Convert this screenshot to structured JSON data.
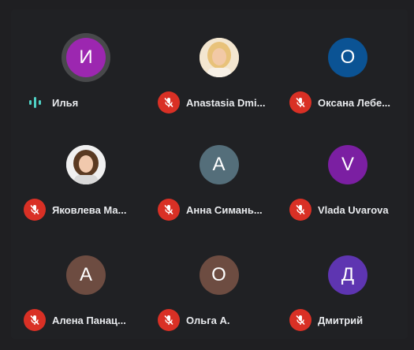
{
  "participants": [
    {
      "name": "Илья",
      "initial": "И",
      "color": "#9c27b0",
      "muted": false,
      "speaking": true,
      "avatar": "letter"
    },
    {
      "name": "Anastasia Dmi...",
      "initial": "",
      "color": "#f0d4a8",
      "muted": true,
      "speaking": false,
      "avatar": "photo-blonde"
    },
    {
      "name": "Оксана Лебе...",
      "initial": "О",
      "color": "#0b5394",
      "muted": true,
      "speaking": false,
      "avatar": "letter"
    },
    {
      "name": "Яковлева Ма...",
      "initial": "",
      "color": "#eeeeee",
      "muted": true,
      "speaking": false,
      "avatar": "photo-brunette"
    },
    {
      "name": "Анна Симань...",
      "initial": "А",
      "color": "#546e7a",
      "muted": true,
      "speaking": false,
      "avatar": "letter"
    },
    {
      "name": "Vlada Uvarova",
      "initial": "V",
      "color": "#7b1fa2",
      "muted": true,
      "speaking": false,
      "avatar": "letter"
    },
    {
      "name": "Алена Панац...",
      "initial": "А",
      "color": "#6d4c41",
      "muted": true,
      "speaking": false,
      "avatar": "letter"
    },
    {
      "name": "Ольга А.",
      "initial": "О",
      "color": "#6d4c41",
      "muted": true,
      "speaking": false,
      "avatar": "letter"
    },
    {
      "name": "Дмитрий",
      "initial": "Д",
      "color": "#5e35b1",
      "muted": true,
      "speaking": false,
      "avatar": "letter"
    }
  ],
  "colors": {
    "background": "#202124",
    "mic_off": "#d93025",
    "speaking_indicator": "#4fd1c5"
  },
  "icons": {
    "mic_off": "mic-off-icon",
    "speaking": "audio-level-icon"
  }
}
